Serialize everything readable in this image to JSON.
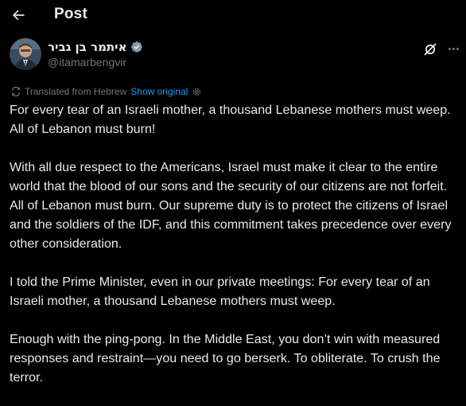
{
  "header": {
    "title": "Post"
  },
  "author": {
    "display_name": "איתמר בן גביר",
    "handle": "@itamarbengvir",
    "verified": true
  },
  "translation": {
    "label": "Translated from Hebrew",
    "show_original": "Show original"
  },
  "post": {
    "paragraphs": [
      "For every tear of an Israeli mother, a thousand Lebanese mothers must weep. All of Lebanon must burn!",
      "With all due respect to the Americans, Israel must make it clear to the entire world that the blood of our sons and the security of our citizens are not forfeit. All of Lebanon must burn. Our supreme duty is to protect the citizens of Israel and the soldiers of the IDF, and this commitment takes precedence over every other consideration.",
      "I told the Prime Minister, even in our private meetings: For every tear of an Israeli mother, a thousand Lebanese mothers must weep.",
      "Enough with the ping-pong. In the Middle East, you don’t win with measured responses and restraint—you need to go berserk. To obliterate. To crush the terror."
    ]
  },
  "colors": {
    "background": "#000000",
    "text": "#e7e9ea",
    "muted": "#71767b",
    "link": "#1d9bf0",
    "verified_badge": "#829aab"
  },
  "icons": {
    "back": "arrow-left-icon",
    "verified": "verified-badge-icon",
    "grok": "grok-icon",
    "more": "more-dots-icon",
    "translate": "translate-icon",
    "settings": "gear-icon"
  }
}
